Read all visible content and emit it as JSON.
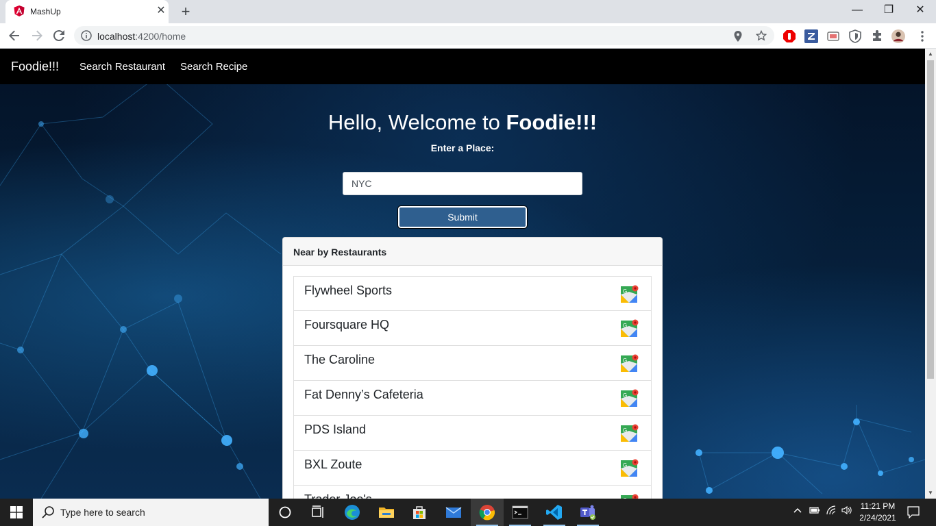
{
  "browser": {
    "tab_title": "MashUp",
    "tab_close": "✕",
    "new_tab": "+",
    "url_host": "localhost",
    "url_rest": ":4200/home",
    "window_controls": {
      "minimize": "—",
      "restore": "❐",
      "close": "✕"
    }
  },
  "navbar": {
    "brand": "Foodie!!!",
    "links": [
      "Search Restaurant",
      "Search Recipe"
    ]
  },
  "hero": {
    "welcome_prefix": "Hello, Welcome to ",
    "welcome_brand": "Foodie!!!",
    "place_label": "Enter a Place:",
    "place_value": "NYC",
    "submit_label": "Submit"
  },
  "restaurants": {
    "header": "Near by Restaurants",
    "items": [
      "Flywheel Sports",
      "Foursquare HQ",
      "The Caroline",
      "Fat Denny’s Cafeteria",
      "PDS Island",
      "BXL Zoute",
      "Trader Joe's"
    ]
  },
  "taskbar": {
    "search_placeholder": "Type here to search",
    "time": "11:21 PM",
    "date": "2/24/2021"
  },
  "icons": {
    "favicon": "angular-icon",
    "map": "google-maps-icon"
  },
  "colors": {
    "navbar": "#000000",
    "submit": "#2f5f8f",
    "angular_red": "#dd0031"
  }
}
